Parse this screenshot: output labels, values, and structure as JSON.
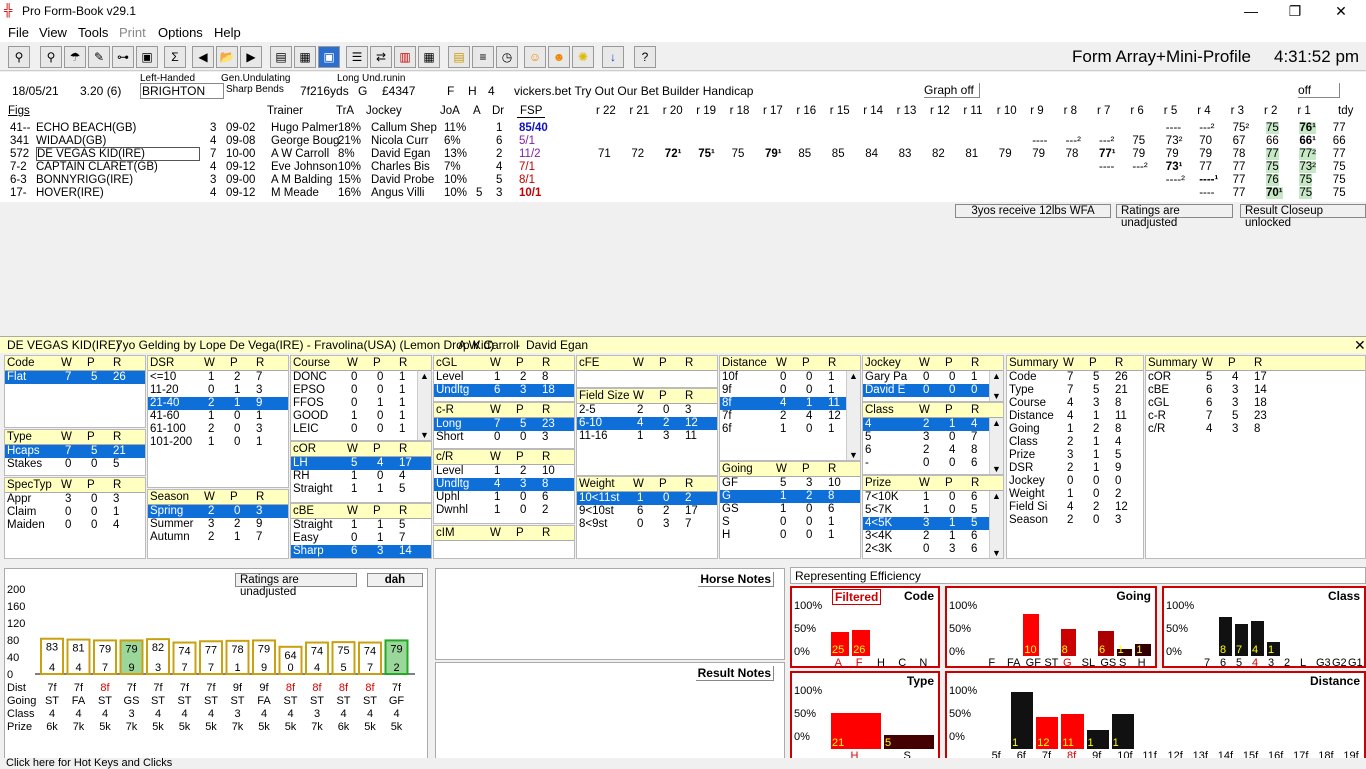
{
  "title": "Pro Form-Book v29.1",
  "menu": [
    "File",
    "View",
    "Tools",
    "Print",
    "Options",
    "Help"
  ],
  "view_title": "Form Array+Mini-Profile",
  "clock": "4:31:52 pm",
  "race": {
    "date": "18/05/21",
    "time": "3.20 (6)",
    "handed": "Left-Handed",
    "course": "BRIGHTON",
    "undul": "Gen.Undulating",
    "bends": "Sharp Bends",
    "dist": "7f216yds",
    "going": "G",
    "prize": "£4347",
    "straight": "Long Und.runin",
    "f": "F",
    "h": "H",
    "num": "4",
    "name": "vickers.bet Try Out Our Bet Builder Handicap",
    "graph": "Graph off",
    "off": "off"
  },
  "grid_headers": [
    "Figs",
    "Trainer",
    "TrA",
    "Jockey",
    "JoA",
    "A",
    "Dr",
    "FSP",
    "r 22",
    "r 21",
    "r 20",
    "r 19",
    "r 18",
    "r 17",
    "r 16",
    "r 15",
    "r 14",
    "r 13",
    "r 12",
    "r 11",
    "r 10",
    "r 9",
    "r 8",
    "r 7",
    "r 6",
    "r 5",
    "r 4",
    "r 3",
    "r 2",
    "r 1",
    "tdy"
  ],
  "runners": [
    {
      "figs": "41--",
      "name": "ECHO BEACH(GB)",
      "age": "3",
      "wt": "09-02",
      "trainer": "Hugo Palmer",
      "tra": "18%",
      "jockey": "Callum Shep",
      "joa": "11%",
      "a": "",
      "dr": "1",
      "fsp": "85/40",
      "fsp_color": "#1010c0",
      "r": [
        "",
        "",
        "",
        "",
        "",
        "",
        "",
        "",
        "",
        "",
        "",
        "",
        "",
        "",
        "",
        "",
        "----",
        "---²",
        "75²",
        "75",
        "76¹",
        "77"
      ]
    },
    {
      "figs": "341",
      "name": "WIDAAD(GB)",
      "age": "4",
      "wt": "09-08",
      "trainer": "George Boug",
      "tra": "21%",
      "jockey": "Nicola Curr",
      "joa": "6%",
      "a": "",
      "dr": "6",
      "fsp": "5/1",
      "fsp_color": "#8020a0",
      "r": [
        "",
        "",
        "",
        "",
        "",
        "",
        "",
        "",
        "",
        "",
        "",
        "",
        "----",
        "---²",
        "---²",
        "75",
        "73²",
        "70",
        "67",
        "66",
        "66¹",
        "66"
      ]
    },
    {
      "figs": "572",
      "name": "DE VEGAS KID(IRE)",
      "age": "7",
      "wt": "10-00",
      "trainer": "A W Carroll",
      "tra": "8%",
      "jockey": "David Egan",
      "joa": "13%",
      "a": "",
      "dr": "2",
      "fsp": "11/2",
      "fsp_color": "#8020a0",
      "r": [
        "71",
        "72",
        "72¹",
        "75¹",
        "75",
        "79¹",
        "85",
        "85",
        "84",
        "83",
        "82",
        "81",
        "79",
        "79",
        "78",
        "77¹",
        "79",
        "79",
        "79",
        "78",
        "77",
        "77²",
        "77"
      ]
    },
    {
      "figs": "7-2",
      "name": "CAPTAIN CLARET(GB)",
      "age": "4",
      "wt": "09-12",
      "trainer": "Eve Johnson",
      "tra": "10%",
      "jockey": "Charles Bis",
      "joa": "7%",
      "a": "",
      "dr": "4",
      "fsp": "7/1",
      "fsp_color": "#c00000",
      "r": [
        "",
        "",
        "",
        "",
        "",
        "",
        "",
        "",
        "",
        "",
        "",
        "",
        "",
        "",
        "",
        "----",
        "---²",
        "73¹",
        "77",
        "77",
        "75",
        "73²",
        "75"
      ]
    },
    {
      "figs": "6-3",
      "name": "BONNYRIGG(IRE)",
      "age": "3",
      "wt": "09-00",
      "trainer": "A M Balding",
      "tra": "15%",
      "jockey": "David Probe",
      "joa": "10%",
      "a": "",
      "dr": "5",
      "fsp": "8/1",
      "fsp_color": "#c00000",
      "r": [
        "",
        "",
        "",
        "",
        "",
        "",
        "",
        "",
        "",
        "",
        "",
        "",
        "",
        "",
        "",
        "",
        "----²",
        "----¹",
        "77",
        "76",
        "75",
        "75"
      ]
    },
    {
      "figs": "17-",
      "name": "HOVER(IRE)",
      "age": "4",
      "wt": "09-12",
      "trainer": "M Meade",
      "tra": "16%",
      "jockey": "Angus Villi",
      "joa": "10%",
      "a": "5",
      "dr": "3",
      "fsp": "10/1",
      "fsp_color": "#c00000",
      "r": [
        "",
        "",
        "",
        "",
        "",
        "",
        "",
        "",
        "",
        "",
        "",
        "",
        "",
        "",
        "",
        "",
        "----",
        "77",
        "70¹",
        "75",
        "75"
      ]
    }
  ],
  "buttons": {
    "wfa": "3yos receive 12lbs WFA",
    "unadj": "Ratings are unadjusted",
    "closeup": "Result Closeup unlocked"
  },
  "profile_line": {
    "name": "DE VEGAS KID(IRE)",
    "desc": "7yo Gelding by Lope De Vega(IRE) - Fravolina(USA) (Lemon Drop Kid)",
    "trainer": "A W Carroll",
    "jockey": "David Egan"
  },
  "chart_buttons": {
    "unadj": "Ratings are unadjusted",
    "dah": "dah"
  },
  "notes": {
    "horse": "Horse Notes",
    "result": "Result Notes",
    "eff": "Representing Efficiency"
  },
  "status": "Click here for Hot Keys and Clicks",
  "chart_data": {
    "type": "bar",
    "ylim": [
      0,
      200
    ],
    "yticks": [
      "200",
      "160",
      "120",
      "80",
      "40",
      "0"
    ],
    "values": [
      83,
      81,
      79,
      79,
      82,
      74,
      77,
      78,
      79,
      64,
      74,
      75,
      74,
      79
    ],
    "bottom": [
      "4",
      "4",
      "7",
      "9",
      "3",
      "7",
      "7",
      "1",
      "9",
      "0",
      "4",
      "5",
      "7",
      "2"
    ],
    "dist": [
      "7f",
      "7f",
      "8f",
      "7f",
      "7f",
      "7f",
      "7f",
      "9f",
      "9f",
      "8f",
      "8f",
      "8f",
      "8f",
      "7f"
    ],
    "going": [
      "ST",
      "FA",
      "ST",
      "GS",
      "ST",
      "ST",
      "ST",
      "ST",
      "FA",
      "ST",
      "ST",
      "ST",
      "ST",
      "GF"
    ],
    "class": [
      "4",
      "4",
      "4",
      "3",
      "4",
      "4",
      "4",
      "3",
      "4",
      "4",
      "3",
      "4",
      "4",
      "4"
    ],
    "prize": [
      "6k",
      "7k",
      "5k",
      "7k",
      "5k",
      "5k",
      "5k",
      "7k",
      "5k",
      "5k",
      "7k",
      "6k",
      "5k",
      "5k"
    ],
    "row_labels": [
      "Dist",
      "Going",
      "Class",
      "Prize"
    ]
  }
}
